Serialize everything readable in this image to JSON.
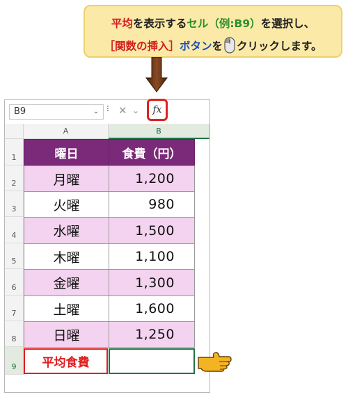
{
  "callout": {
    "line1": {
      "p1": "平均",
      "p2": "を表示する",
      "p3": "セル（例:B9）",
      "p4": "を選択し、"
    },
    "line2": {
      "p1": "［関数の挿入］",
      "p2": "ボタン",
      "p3": "を",
      "p4": "クリックします。"
    }
  },
  "formula_bar": {
    "name_box": "B9",
    "cancel_icon": "close-icon",
    "enter_icon": "check-icon",
    "fx_label": "fx"
  },
  "columns": [
    "A",
    "B"
  ],
  "rows": [
    "1",
    "2",
    "3",
    "4",
    "5",
    "6",
    "7",
    "8",
    "9"
  ],
  "table": {
    "headers": [
      "曜日",
      "食費（円）"
    ],
    "rows": [
      {
        "day": "月曜",
        "amount": "1,200"
      },
      {
        "day": "火曜",
        "amount": "980"
      },
      {
        "day": "水曜",
        "amount": "1,500"
      },
      {
        "day": "木曜",
        "amount": "1,100"
      },
      {
        "day": "金曜",
        "amount": "1,300"
      },
      {
        "day": "土曜",
        "amount": "1,600"
      },
      {
        "day": "日曜",
        "amount": "1,250"
      }
    ],
    "average_label": "平均食費",
    "average_value": ""
  },
  "colors": {
    "header_purple": "#7a2a78",
    "row_pink": "#f3d3ef",
    "highlight_red": "#e02020",
    "selection_green": "#217346"
  }
}
